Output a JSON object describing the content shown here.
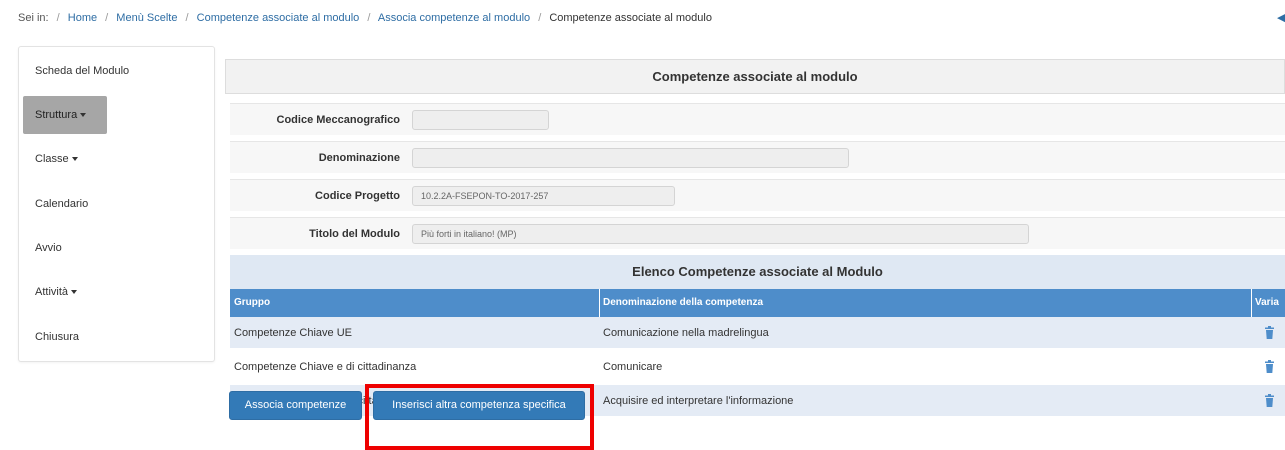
{
  "breadcrumb": {
    "prefix": "Sei in:",
    "items": [
      "Home",
      "Menù Scelte",
      "Competenze associate al modulo",
      "Associa competenze al modulo"
    ],
    "current": "Competenze associate al modulo"
  },
  "sidebar": {
    "items": [
      {
        "label": "Scheda del Modulo"
      },
      {
        "label": "Struttura"
      },
      {
        "label": "Classe"
      },
      {
        "label": "Calendario"
      },
      {
        "label": "Avvio"
      },
      {
        "label": "Attività"
      },
      {
        "label": "Chiusura"
      }
    ]
  },
  "panel": {
    "title": "Competenze associate al modulo",
    "fields": [
      {
        "label": "Codice Meccanografico",
        "value": ""
      },
      {
        "label": "Denominazione",
        "value": ""
      },
      {
        "label": "Codice Progetto",
        "value": "10.2.2A-FSEPON-TO-2017-257"
      },
      {
        "label": "Titolo del Modulo",
        "value": "Più forti in italiano! (MP)"
      }
    ]
  },
  "list": {
    "title": "Elenco Competenze associate al Modulo",
    "columns": [
      "Gruppo",
      "Denominazione della competenza",
      "Varia"
    ],
    "rows": [
      {
        "gruppo": "Competenze Chiave UE",
        "competenza": "Comunicazione nella madrelingua"
      },
      {
        "gruppo": "Competenze Chiave e di cittadinanza",
        "competenza": "Comunicare"
      },
      {
        "gruppo": "Competenze Chiave e di cittadinanza",
        "competenza": "Acquisire ed interpretare l'informazione"
      }
    ]
  },
  "buttons": {
    "associa": "Associa competenze",
    "inserisci": "Inserisci altra competenza specifica"
  },
  "colors": {
    "accent": "#337ab7",
    "table_header": "#4e8dca",
    "highlight": "#ee0000"
  }
}
